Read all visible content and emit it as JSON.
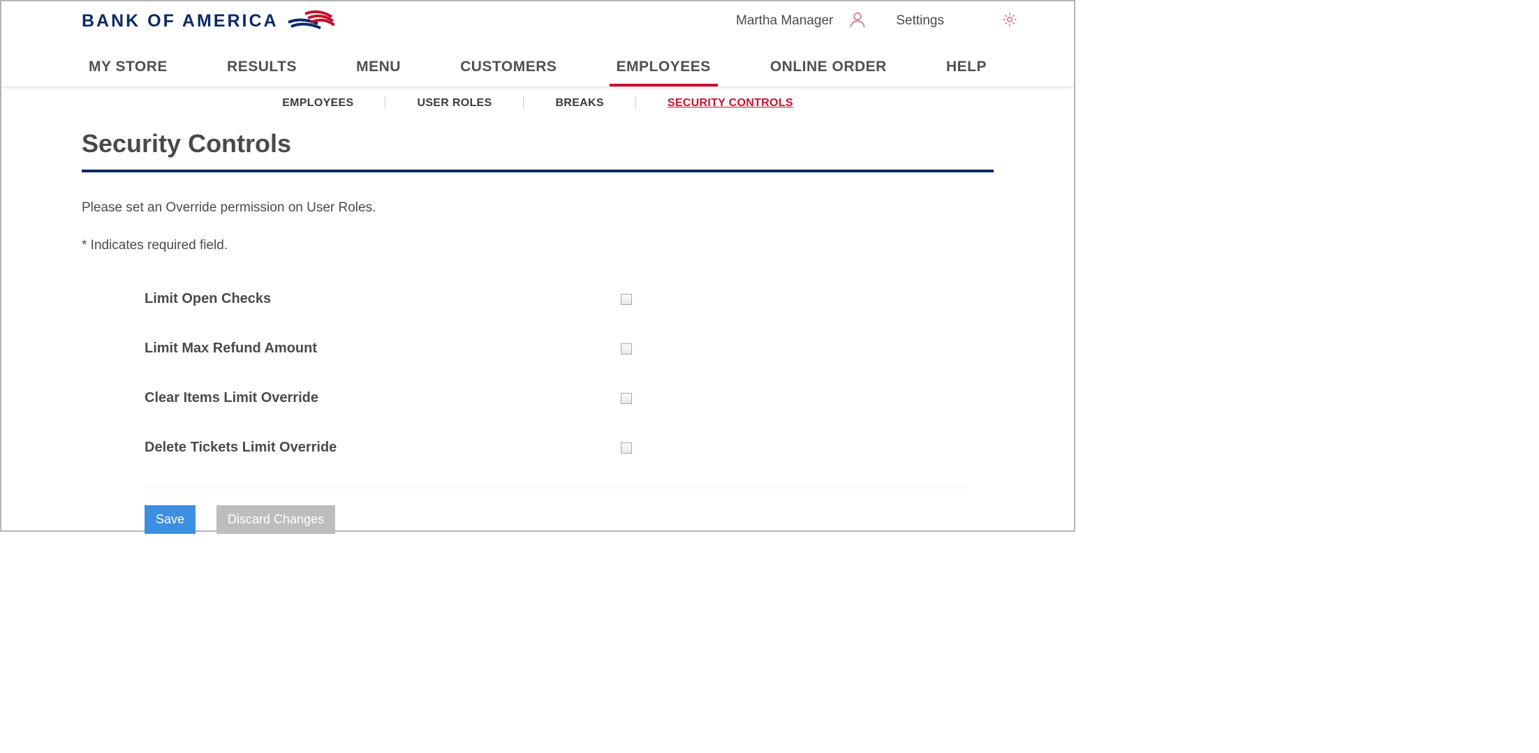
{
  "header": {
    "logo_text": "BANK OF AMERICA",
    "user_name": "Martha Manager",
    "settings_label": "Settings"
  },
  "main_nav": [
    {
      "label": "MY STORE",
      "active": false
    },
    {
      "label": "RESULTS",
      "active": false
    },
    {
      "label": "MENU",
      "active": false
    },
    {
      "label": "CUSTOMERS",
      "active": false
    },
    {
      "label": "EMPLOYEES",
      "active": true
    },
    {
      "label": "ONLINE ORDER",
      "active": false
    },
    {
      "label": "HELP",
      "active": false
    }
  ],
  "sub_nav": [
    {
      "label": "EMPLOYEES",
      "active": false
    },
    {
      "label": "USER ROLES",
      "active": false
    },
    {
      "label": "BREAKS",
      "active": false
    },
    {
      "label": "SECURITY CONTROLS",
      "active": true
    }
  ],
  "page": {
    "title": "Security Controls",
    "intro": "Please set an Override permission on User Roles.",
    "required_note": "* Indicates required field."
  },
  "form": {
    "rows": [
      {
        "label": "Limit Open Checks",
        "checked": false
      },
      {
        "label": "Limit Max Refund Amount",
        "checked": false
      },
      {
        "label": "Clear Items Limit Override",
        "checked": false
      },
      {
        "label": "Delete Tickets Limit Override",
        "checked": false
      }
    ],
    "save_label": "Save",
    "discard_label": "Discard Changes"
  }
}
